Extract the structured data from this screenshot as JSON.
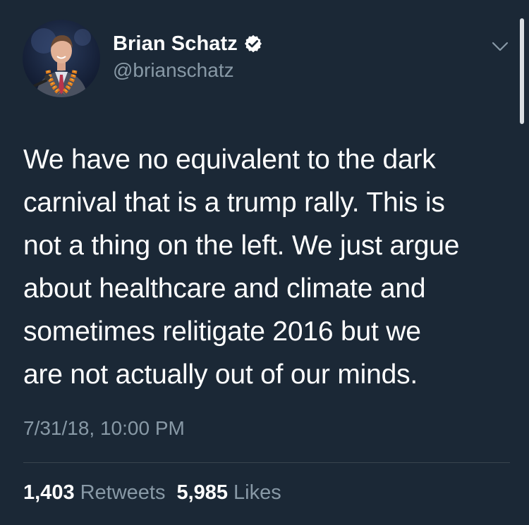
{
  "author": {
    "display_name": "Brian Schatz",
    "handle": "@brianschatz",
    "verified": true
  },
  "tweet": {
    "text_lines": [
      "We have no equivalent to the dark",
      "carnival that is a trump rally. This is",
      "not a thing on the left. We just argue",
      "about healthcare and climate and",
      "sometimes relitigate 2016 but we",
      "are not actually out of our minds."
    ],
    "timestamp": "7/31/18, 10:00 PM"
  },
  "stats": {
    "retweets_count": "1,403",
    "retweets_label": "Retweets",
    "likes_count": "5,985",
    "likes_label": "Likes"
  },
  "icons": {
    "verified": "verified-badge-icon",
    "menu": "chevron-down-icon"
  },
  "colors": {
    "background": "#1b2836",
    "primary_text": "#ffffff",
    "secondary_text": "#8899a6",
    "divider": "#38444d"
  }
}
